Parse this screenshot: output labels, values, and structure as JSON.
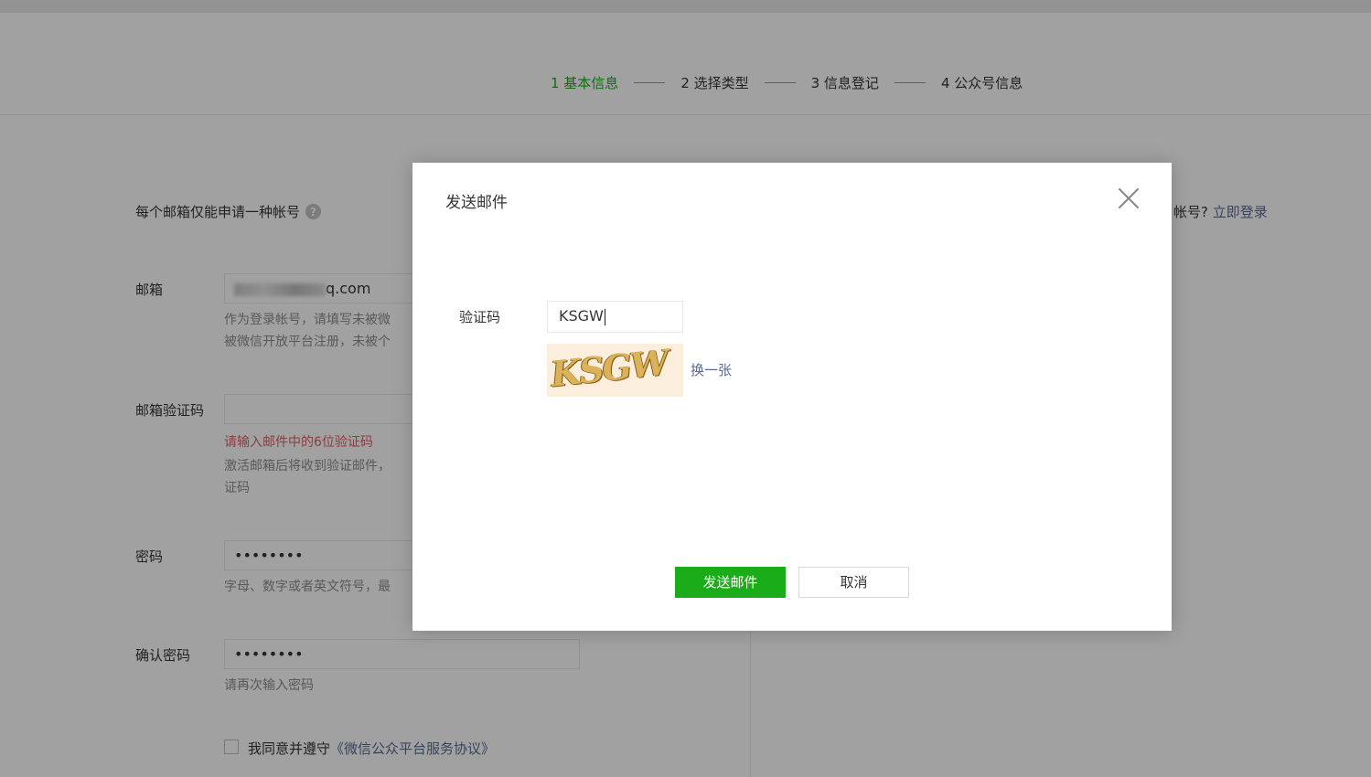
{
  "steps": [
    {
      "label": "1 基本信息",
      "active": true
    },
    {
      "label": "2 选择类型",
      "active": false
    },
    {
      "label": "3 信息登记",
      "active": false
    },
    {
      "label": "4 公众号信息",
      "active": false
    }
  ],
  "form": {
    "tip": "每个邮箱仅能申请一种帐号",
    "login_prompt": "帐号?",
    "login_link": "立即登录",
    "email": {
      "label": "邮箱",
      "value_suffix": "q.com",
      "hint_line1": "作为登录帐号，请填写未被微",
      "hint_line2": "被微信开放平台注册，未被个"
    },
    "email_code": {
      "label": "邮箱验证码",
      "error": "请输入邮件中的6位验证码",
      "hint_line1": "激活邮箱后将收到验证邮件，",
      "hint_line2": "证码"
    },
    "password": {
      "label": "密码",
      "value": "••••••••",
      "hint": "字母、数字或者英文符号，最"
    },
    "confirm_password": {
      "label": "确认密码",
      "value": "••••••••",
      "hint": "请再次输入密码"
    },
    "agreement_prefix": "我同意并遵守",
    "agreement_link": "《微信公众平台服务协议》"
  },
  "dialog": {
    "title": "发送邮件",
    "captcha_label": "验证码",
    "captcha_value": "KSGW",
    "captcha_image_text": "KSGW",
    "refresh_label": "换一张",
    "send_label": "发送邮件",
    "cancel_label": "取消"
  },
  "colors": {
    "accent": "#1aad19",
    "link": "#576b95",
    "error": "#e15f63"
  }
}
